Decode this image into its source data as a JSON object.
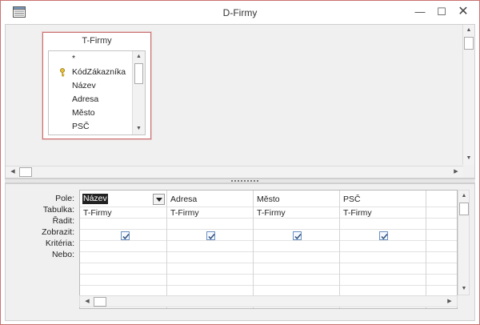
{
  "window": {
    "title": "D-Firmy",
    "minimize_glyph": "—",
    "maximize_glyph": "☐",
    "close_glyph": "✕",
    "app_icon": "table-window-icon"
  },
  "diagram": {
    "table_title": "T-Firmy",
    "fields": [
      {
        "label": "*",
        "primary_key": false
      },
      {
        "label": "KódZákazníka",
        "primary_key": true
      },
      {
        "label": "Název",
        "primary_key": false
      },
      {
        "label": "Adresa",
        "primary_key": false
      },
      {
        "label": "Město",
        "primary_key": false
      },
      {
        "label": "PSČ",
        "primary_key": false
      }
    ]
  },
  "grid": {
    "row_labels": {
      "pole": "Pole:",
      "tabulka": "Tabulka:",
      "radit": "Řadit:",
      "zobrazit": "Zobrazit:",
      "kriteria": "Kritéria:",
      "nebo": "Nebo:"
    },
    "columns": [
      {
        "field": "Název",
        "table": "T-Firmy",
        "show": true,
        "selected": true
      },
      {
        "field": "Adresa",
        "table": "T-Firmy",
        "show": true,
        "selected": false
      },
      {
        "field": "Město",
        "table": "T-Firmy",
        "show": true,
        "selected": false
      },
      {
        "field": "PSČ",
        "table": "T-Firmy",
        "show": true,
        "selected": false
      }
    ]
  },
  "colors": {
    "window_border": "#c9716f",
    "pane_background": "#f0f0f0",
    "checkbox_border": "#6a8fbf"
  }
}
